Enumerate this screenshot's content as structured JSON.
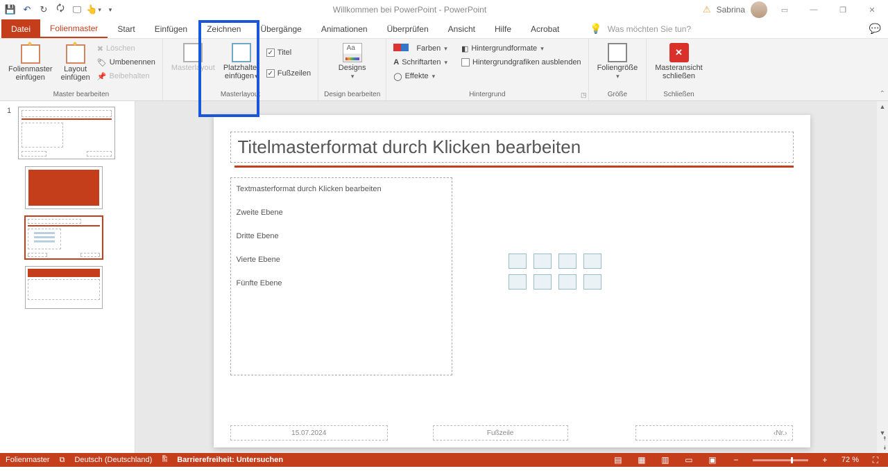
{
  "titlebar": {
    "title": "Willkommen bei PowerPoint  -  PowerPoint",
    "user": "Sabrina"
  },
  "tabs": {
    "file": "Datei",
    "items": [
      "Folienmaster",
      "Start",
      "Einfügen",
      "Zeichnen",
      "Übergänge",
      "Animationen",
      "Überprüfen",
      "Ansicht",
      "Hilfe",
      "Acrobat"
    ],
    "active": 0,
    "tellme": "Was möchten Sie tun?"
  },
  "ribbon": {
    "grp_edit": {
      "label": "Master bearbeiten",
      "slide_master": "Folienmaster\neinfügen",
      "layout": "Layout\neinfügen",
      "delete": "Löschen",
      "rename": "Umbenennen",
      "preserve": "Beibehalten"
    },
    "grp_layout": {
      "label": "Masterlayout",
      "master_layout": "Masterlayout",
      "placeholder": "Platzhalter\neinfügen",
      "title": "Titel",
      "footers": "Fußzeilen"
    },
    "grp_theme": {
      "label": "Design bearbeiten",
      "designs": "Designs"
    },
    "grp_bg": {
      "label": "Hintergrund",
      "colors": "Farben",
      "fonts": "Schriftarten",
      "effects": "Effekte",
      "styles": "Hintergrundformate",
      "hide": "Hintergrundgrafiken ausblenden"
    },
    "grp_size": {
      "label": "Größe",
      "btn": "Foliengröße"
    },
    "grp_close": {
      "label": "Schließen",
      "btn": "Masteransicht\nschließen"
    }
  },
  "slide": {
    "title": "Titelmasterformat durch Klicken bearbeiten",
    "body": [
      "Textmasterformat durch Klicken bearbeiten",
      "Zweite Ebene",
      "Dritte Ebene",
      "Vierte Ebene",
      "Fünfte Ebene"
    ],
    "date": "15.07.2024",
    "footer": "Fußzeile",
    "num": "‹Nr.›"
  },
  "status": {
    "mode": "Folienmaster",
    "lang": "Deutsch (Deutschland)",
    "a11y": "Barrierefreiheit: Untersuchen",
    "zoom": "72 %"
  }
}
